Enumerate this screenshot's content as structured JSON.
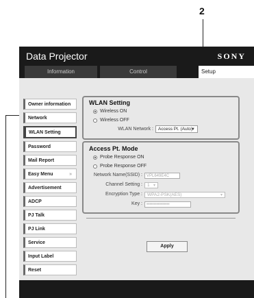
{
  "callout": "2",
  "app": {
    "title": "Data Projector",
    "brand": "SONY"
  },
  "tabs": {
    "information": "Information",
    "control": "Control",
    "setup": "Setup"
  },
  "sidebar": {
    "items": [
      {
        "label": "Owner information"
      },
      {
        "label": "Network"
      },
      {
        "label": "WLAN Setting"
      },
      {
        "label": "Password"
      },
      {
        "label": "Mail Report"
      },
      {
        "label": "Easy Menu"
      },
      {
        "label": "Advertisement"
      },
      {
        "label": "ADCP"
      },
      {
        "label": "PJ Talk"
      },
      {
        "label": "PJ Link"
      },
      {
        "label": "Service"
      },
      {
        "label": "Input Label"
      },
      {
        "label": "Reset"
      }
    ],
    "active": "WLAN Setting",
    "easy_menu_chevron": "»"
  },
  "wlan": {
    "title": "WLAN Setting",
    "wireless_on": "Wireless ON",
    "wireless_off": "Wireless OFF",
    "selected": "Wireless ON",
    "network_label": "WLAN Network :",
    "network_value": "Access Pt. (Auto)"
  },
  "ap": {
    "title": "Access Pt. Mode",
    "probe_on": "Probe Response ON",
    "probe_off": "Probe Response OFF",
    "selected": "Probe Response ON",
    "ssid_label": "Network Name(SSID) :",
    "ssid_value": "VPL649E4C",
    "channel_label": "Channel Setting :",
    "channel_value": "1",
    "encryption_label": "Encryption Type :",
    "encryption_value": "WPA2-PSK(AES)",
    "key_label": "Key :",
    "key_value": "••••••••••••••••"
  },
  "apply_label": "Apply"
}
